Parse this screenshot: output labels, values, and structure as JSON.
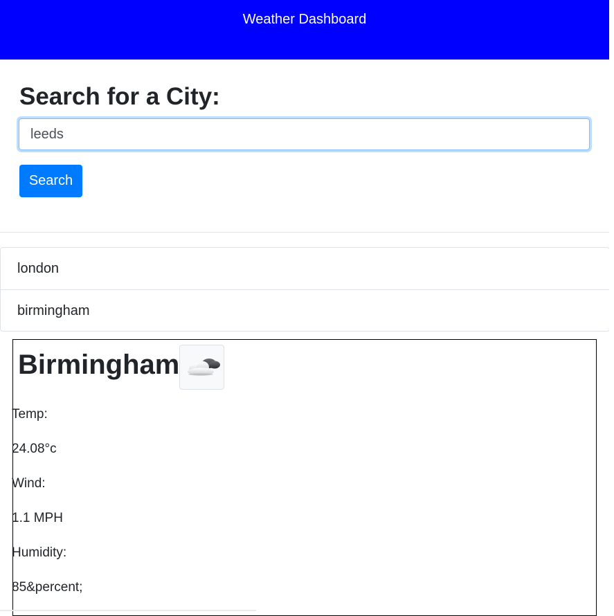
{
  "header": {
    "title": "Weather Dashboard"
  },
  "search": {
    "heading": "Search for a City:",
    "input_value": "leeds",
    "button_label": "Search"
  },
  "history": {
    "items": [
      {
        "label": "london"
      },
      {
        "label": "birmingham"
      }
    ]
  },
  "current_weather": {
    "city": "Birmingham",
    "icon": "cloud-icon",
    "temp_label": "Temp:",
    "temp_value": "24.08°c",
    "wind_label": "Wind:",
    "wind_value": "1.1 MPH",
    "humidity_label": "Humidity:",
    "humidity_value": "85&percent;"
  },
  "colors": {
    "header_bg": "#0000ff",
    "button_bg": "#007bff",
    "text": "#212529",
    "border": "#dee2e6"
  }
}
